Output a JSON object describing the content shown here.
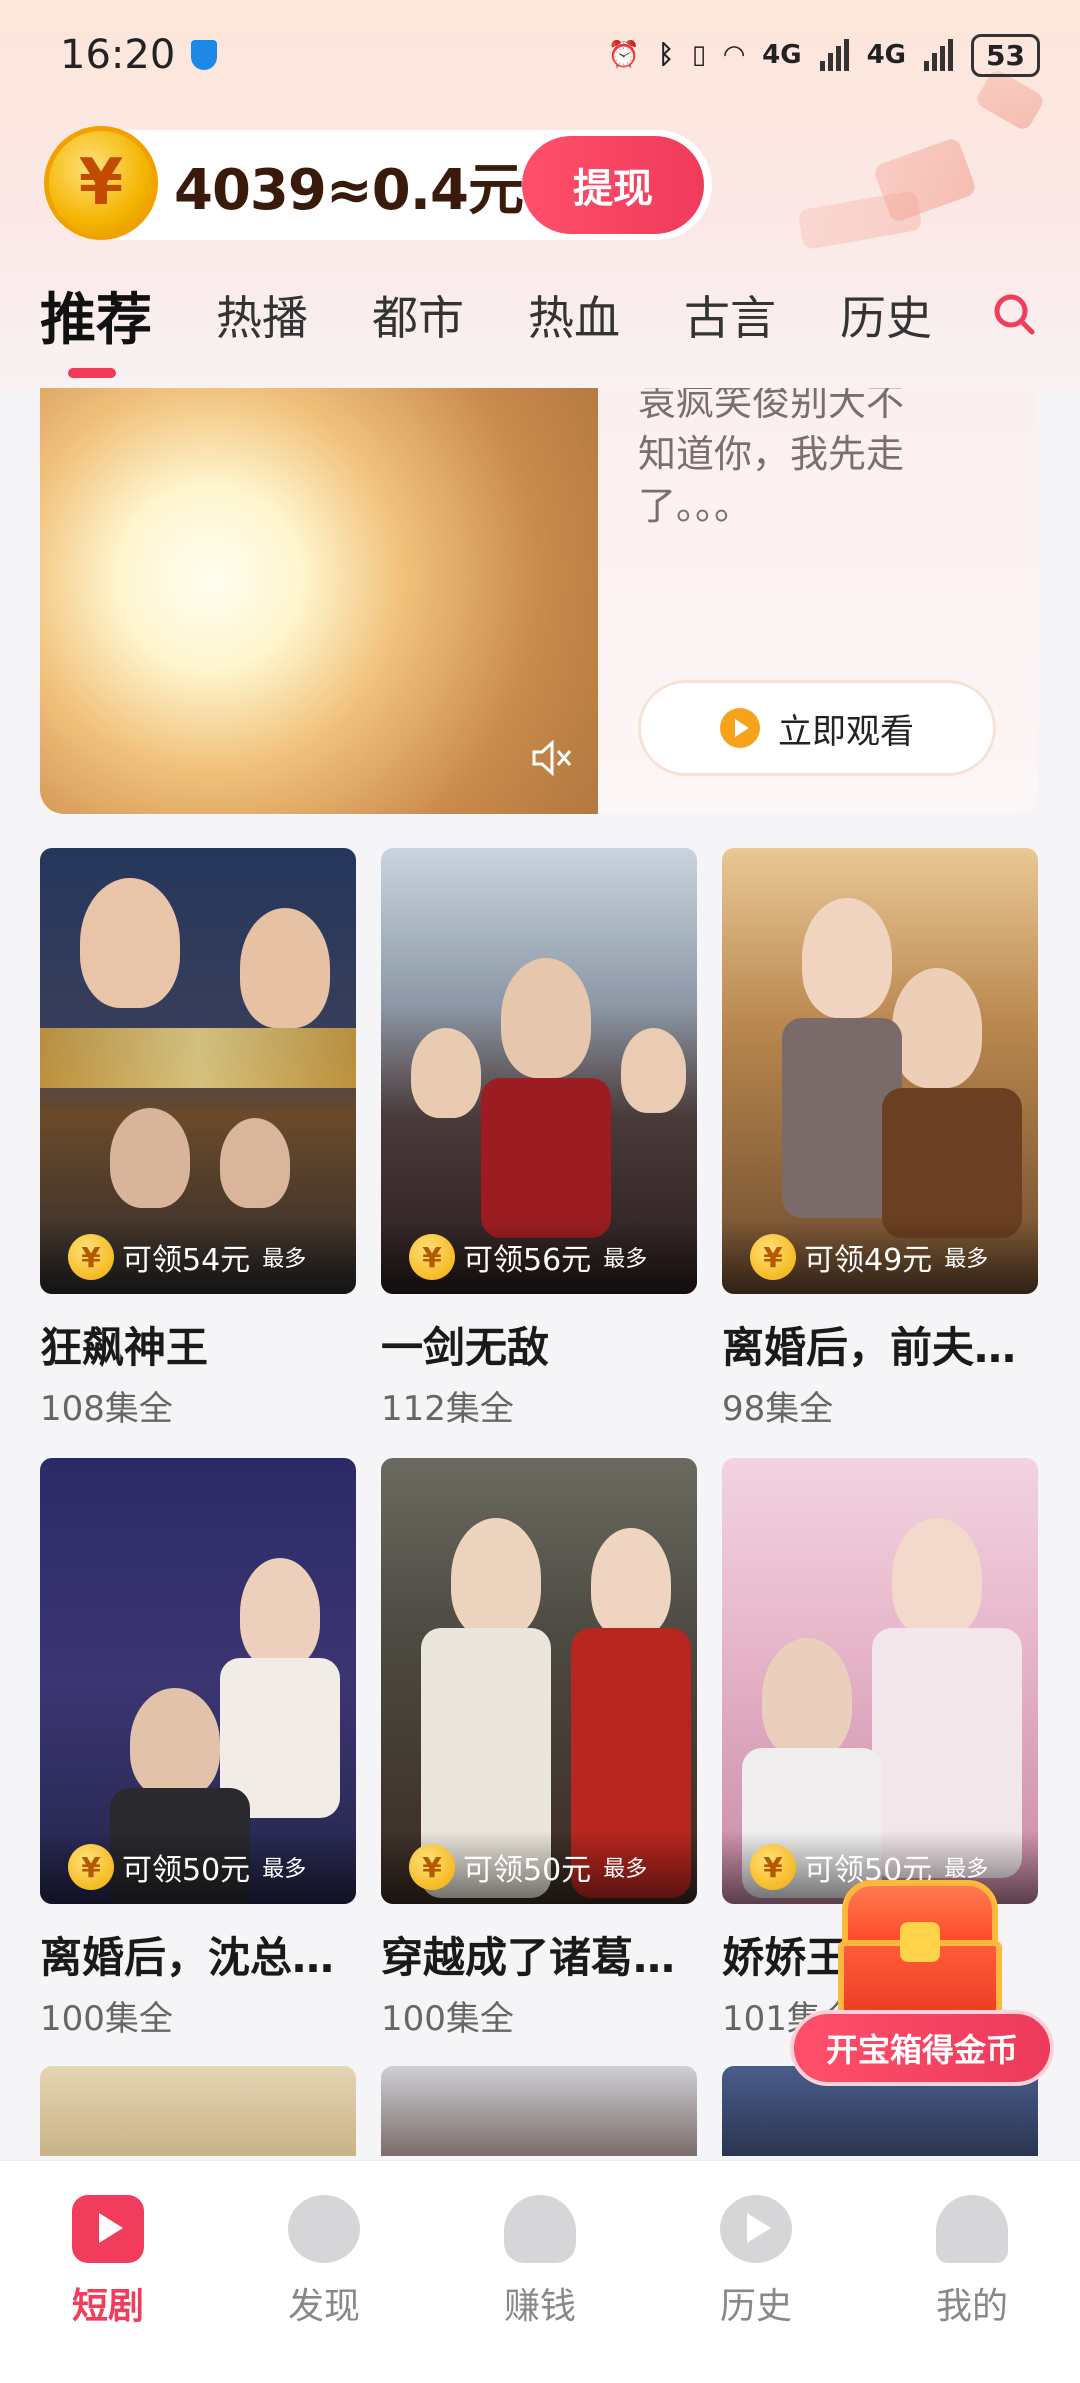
{
  "status_bar": {
    "time": "16:20",
    "network": "4G",
    "battery": "53"
  },
  "header": {
    "coin_text": "4039≈0.4元",
    "withdraw_label": "提现",
    "tabs": [
      {
        "label": "推荐",
        "active": true
      },
      {
        "label": "热播"
      },
      {
        "label": "都市"
      },
      {
        "label": "热血"
      },
      {
        "label": "古言"
      },
      {
        "label": "历史"
      }
    ]
  },
  "featured": {
    "description": "袁疯笑俊别大不知道你，我先走了。。。",
    "watch_label": "立即观看"
  },
  "dramas": [
    {
      "title": "狂飙神王",
      "episodes": "108集全",
      "reward": "可领54元",
      "reward_max": "最多"
    },
    {
      "title": "一剑无敌",
      "episodes": "112集全",
      "reward": "可领56元",
      "reward_max": "最多"
    },
    {
      "title": "离婚后，前夫…",
      "episodes": "98集全",
      "reward": "可领49元",
      "reward_max": "最多"
    },
    {
      "title": "离婚后，沈总…",
      "episodes": "100集全",
      "reward": "可领50元",
      "reward_max": "最多"
    },
    {
      "title": "穿越成了诸葛…",
      "episodes": "100集全",
      "reward": "可领50元",
      "reward_max": "最多"
    },
    {
      "title": "娇娇王…",
      "episodes": "101集全",
      "reward": "可领50元",
      "reward_max": "最多"
    }
  ],
  "treasure": {
    "label": "开宝箱得金币"
  },
  "bottom_nav": [
    {
      "label": "短剧",
      "icon": "tv-play-icon",
      "active": true
    },
    {
      "label": "发现",
      "icon": "discover-icon"
    },
    {
      "label": "赚钱",
      "icon": "money-bag-icon"
    },
    {
      "label": "历史",
      "icon": "history-play-icon"
    },
    {
      "label": "我的",
      "icon": "profile-icon"
    }
  ],
  "colors": {
    "accent": "#f23c5c",
    "coin": "#f4b400"
  }
}
